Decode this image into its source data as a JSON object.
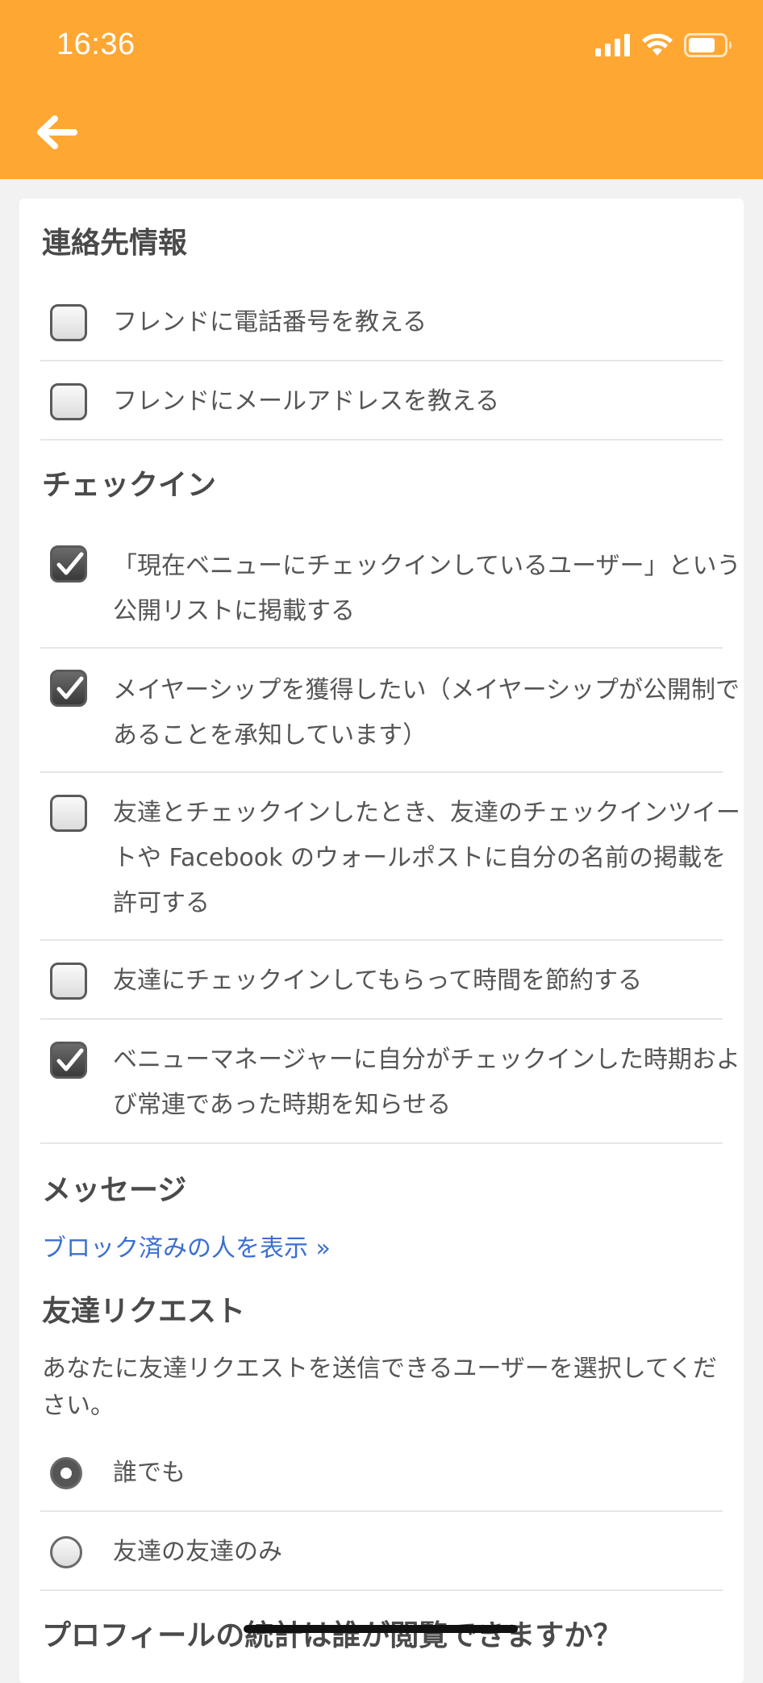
{
  "status_bar": {
    "time": "16:36"
  },
  "colors": {
    "header": "#ffa733",
    "link": "#3b6fd1"
  },
  "nav": {
    "back_icon": "back-arrow-icon"
  },
  "contact": {
    "title": "連絡先情報",
    "items": [
      {
        "label": "フレンドに電話番号を教える",
        "checked": false
      },
      {
        "label": "フレンドにメールアドレスを教える",
        "checked": false
      }
    ]
  },
  "checkin": {
    "title": "チェックイン",
    "items": [
      {
        "label": "「現在ベニューにチェックインしているユーザー」という公開リストに掲載する",
        "checked": true
      },
      {
        "label": "メイヤーシップを獲得したい（メイヤーシップが公開制であることを承知しています）",
        "checked": true
      },
      {
        "label": "友達とチェックインしたとき、友達のチェックインツイートや Facebook のウォールポストに自分の名前の掲載を許可する",
        "checked": false
      },
      {
        "label": "友達にチェックインしてもらって時間を節約する",
        "checked": false
      },
      {
        "label": "ベニューマネージャーに自分がチェックインした時期および常連であった時期を知らせる",
        "checked": true
      }
    ]
  },
  "messages": {
    "title": "メッセージ",
    "blocked_link": "ブロック済みの人を表示 »"
  },
  "friend_requests": {
    "title": "友達リクエスト",
    "description": "あなたに友達リクエストを送信できるユーザーを選択してください。",
    "options": [
      {
        "label": "誰でも",
        "selected": true
      },
      {
        "label": "友達の友達のみ",
        "selected": false
      }
    ]
  },
  "profile_stats": {
    "title": "プロフィールの統計は誰が閲覧できますか？"
  }
}
